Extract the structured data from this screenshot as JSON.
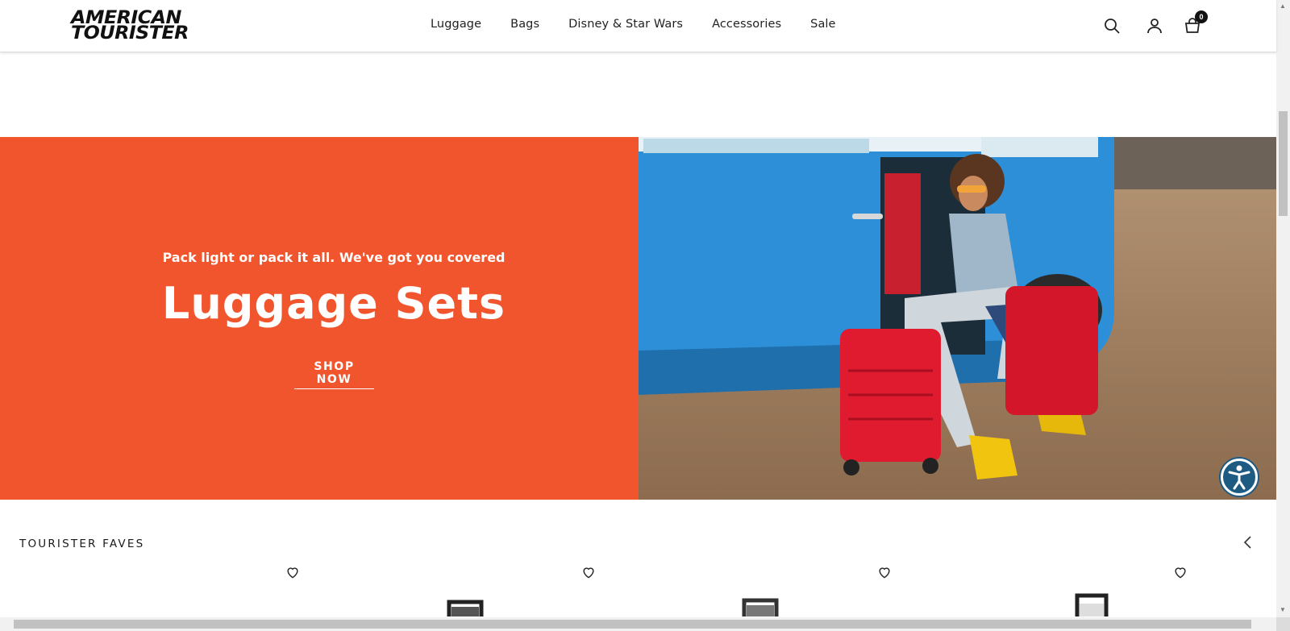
{
  "header": {
    "logo_line1": "AMERICAN",
    "logo_line2": "TOURISTER",
    "nav": [
      "Luggage",
      "Bags",
      "Disney & Star Wars",
      "Accessories",
      "Sale"
    ],
    "cart_count": "0",
    "icons": [
      "search-icon",
      "account-icon",
      "cart-icon"
    ]
  },
  "hero": {
    "subtitle": "Pack light or pack it all. We've got you covered",
    "title": "Luggage Sets",
    "cta": "SHOP NOW",
    "accent_color": "#f0552d"
  },
  "faves": {
    "title": "TOURISTER FAVES",
    "heart_icon": "heart-icon",
    "prev_icon": "chevron-left-icon"
  },
  "accessibility": {
    "icon": "accessibility-icon"
  }
}
